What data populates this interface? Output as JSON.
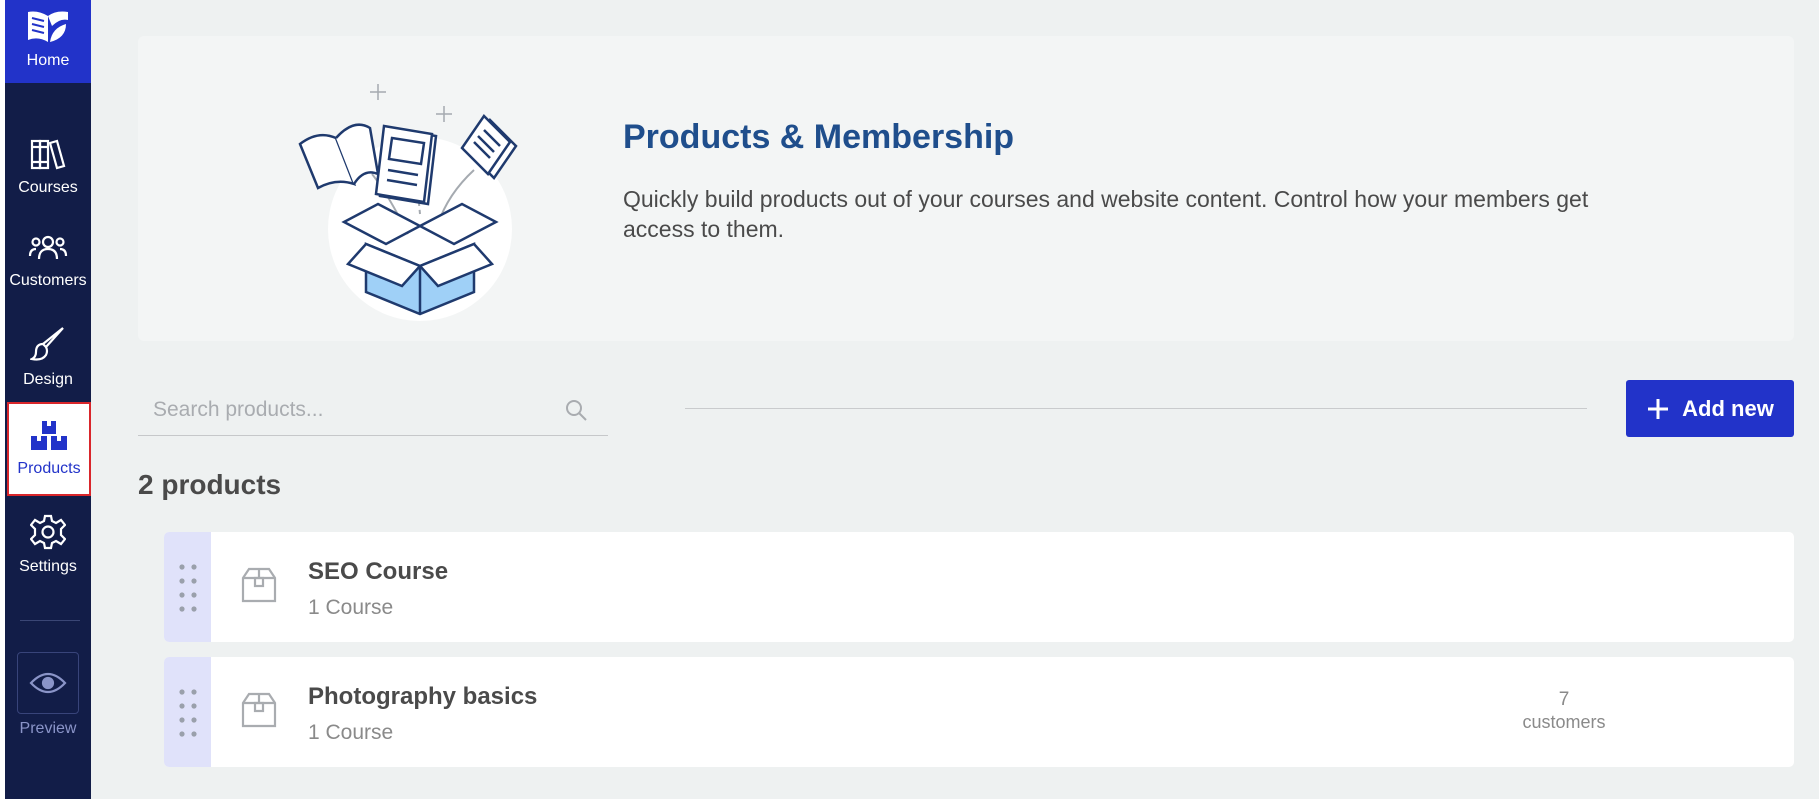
{
  "sidebar": {
    "home": {
      "label": "Home",
      "icon": "book-leaf-logo-icon"
    },
    "items": [
      {
        "label": "Courses",
        "icon": "books-icon"
      },
      {
        "label": "Customers",
        "icon": "people-icon"
      },
      {
        "label": "Design",
        "icon": "paintbrush-icon"
      },
      {
        "label": "Products",
        "icon": "boxes-icon",
        "active": true
      },
      {
        "label": "Settings",
        "icon": "gear-icon"
      }
    ],
    "preview": {
      "label": "Preview",
      "icon": "eye-icon"
    }
  },
  "hero": {
    "title": "Products & Membership",
    "description": "Quickly build products out of your courses and website content. Control how your members get access to them."
  },
  "search": {
    "placeholder": "Search products...",
    "value": ""
  },
  "add_button": {
    "label": "Add new"
  },
  "product_count": "2 products",
  "products": [
    {
      "name": "SEO Course",
      "subtitle": "1 Course",
      "customers_count": "",
      "customers_label": ""
    },
    {
      "name": "Photography basics",
      "subtitle": "1 Course",
      "customers_count": "7",
      "customers_label": "customers"
    }
  ],
  "colors": {
    "sidebar_bg": "#121d48",
    "accent": "#2233c9",
    "hero_title": "#1f4e8c",
    "page_bg": "#eef1f1",
    "drag_handle_bg": "#e0e2fa",
    "active_outline": "#d9262b"
  }
}
